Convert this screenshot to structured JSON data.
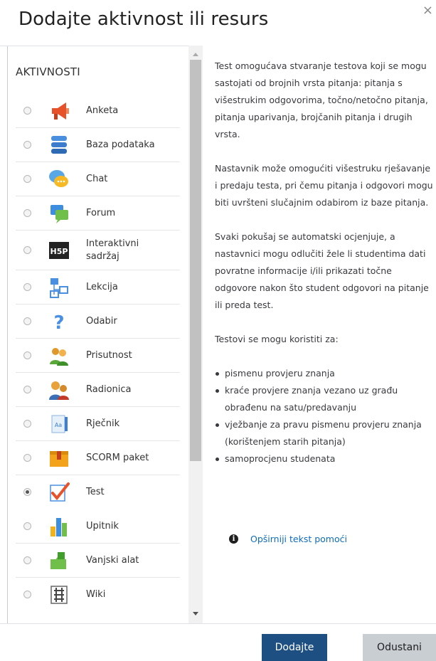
{
  "dialog": {
    "title": "Dodajte aktivnost ili resurs",
    "close": "×"
  },
  "list": {
    "section": "AKTIVNOSTI",
    "items": [
      {
        "label": "Anketa"
      },
      {
        "label": "Baza podataka"
      },
      {
        "label": "Chat"
      },
      {
        "label": "Forum"
      },
      {
        "label": "Interaktivni sadržaj"
      },
      {
        "label": "Lekcija"
      },
      {
        "label": "Odabir"
      },
      {
        "label": "Prisutnost"
      },
      {
        "label": "Radionica"
      },
      {
        "label": "Rječnik"
      },
      {
        "label": "SCORM paket"
      },
      {
        "label": "Test",
        "selected": true
      },
      {
        "label": "Upitnik"
      },
      {
        "label": "Vanjski alat"
      },
      {
        "label": "Wiki"
      }
    ]
  },
  "description": {
    "p1": "Test omogućava stvaranje testova koji se mogu sastojati od brojnih vrsta pitanja: pitanja s višestrukim odgovorima, točno/netočno pitanja, pitanja uparivanja, brojčanih pitanja i drugih vrsta.",
    "p2": "Nastavnik može omogućiti višestruku rješavanje i predaju testa, pri čemu pitanja i odgovori mogu biti uvršteni slučajnim odabirom iz baze pitanja.",
    "p3": "Svaki pokušaj se automatski ocjenjuje, a nastavnici mogu odlučiti žele li studentima dati povratne informacije i/ili prikazati točne odgovore nakon što student odgovori na pitanje ili preda test.",
    "p4": "Testovi se mogu koristiti za:",
    "bullets": [
      "pismenu provjeru znanja",
      "kraće provjere znanja vezano uz građu obrađenu na satu/predavanju",
      "vježbanje za pravu pismenu provjeru znanja (korištenjem starih pitanja)",
      "samoprocjenu studenata"
    ],
    "help_icon": "i",
    "help_link": "Opširniji tekst pomoći"
  },
  "footer": {
    "add": "Dodajte",
    "cancel": "Odustani"
  },
  "colors": {
    "primary": "#1d4f82",
    "secondary": "#c9ced3",
    "link": "#0f6cbf"
  }
}
